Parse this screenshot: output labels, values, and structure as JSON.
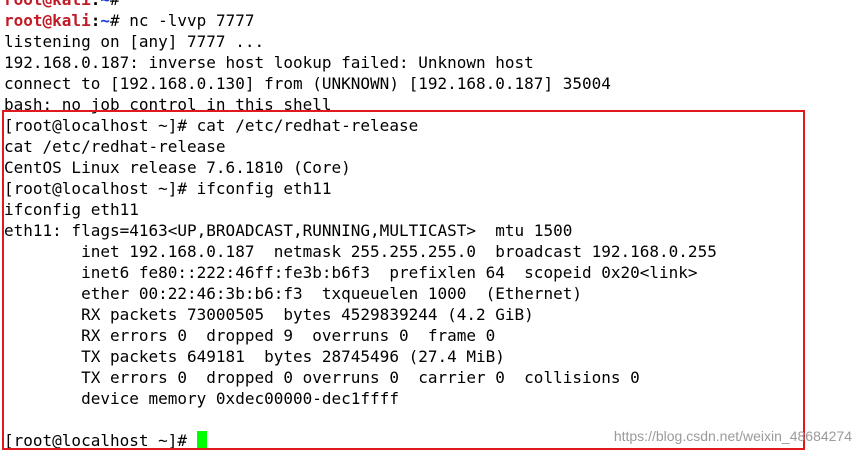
{
  "terminal": {
    "kali_prompt": {
      "user_host": "root@kali",
      "separator": ":",
      "path": "~",
      "symbol": "# "
    },
    "line_0_cmd": "",
    "line_1_cmd": "nc -lvvp 7777",
    "output": [
      "listening on [any] 7777 ...",
      "192.168.0.187: inverse host lookup failed: Unknown host",
      "connect to [192.168.0.130] from (UNKNOWN) [192.168.0.187] 35004",
      "bash: no job control in this shell",
      "[root@localhost ~]# cat /etc/redhat-release",
      "cat /etc/redhat-release",
      "CentOS Linux release 7.6.1810 (Core)",
      "[root@localhost ~]# ifconfig eth11",
      "ifconfig eth11",
      "eth11: flags=4163<UP,BROADCAST,RUNNING,MULTICAST>  mtu 1500",
      "        inet 192.168.0.187  netmask 255.255.255.0  broadcast 192.168.0.255",
      "        inet6 fe80::222:46ff:fe3b:b6f3  prefixlen 64  scopeid 0x20<link>",
      "        ether 00:22:46:3b:b6:f3  txqueuelen 1000  (Ethernet)",
      "        RX packets 73000505  bytes 4529839244 (4.2 GiB)",
      "        RX errors 0  dropped 9  overruns 0  frame 0",
      "        TX packets 649181  bytes 28745496 (27.4 MiB)",
      "        TX errors 0  dropped 0 overruns 0  carrier 0  collisions 0",
      "        device memory 0xdec00000-dec1ffff",
      "",
      "[root@localhost ~]# "
    ],
    "cursor_color": "#00ff00",
    "highlight_color": "#e0191f"
  },
  "watermark": "https://blog.csdn.net/weixin_48684274"
}
